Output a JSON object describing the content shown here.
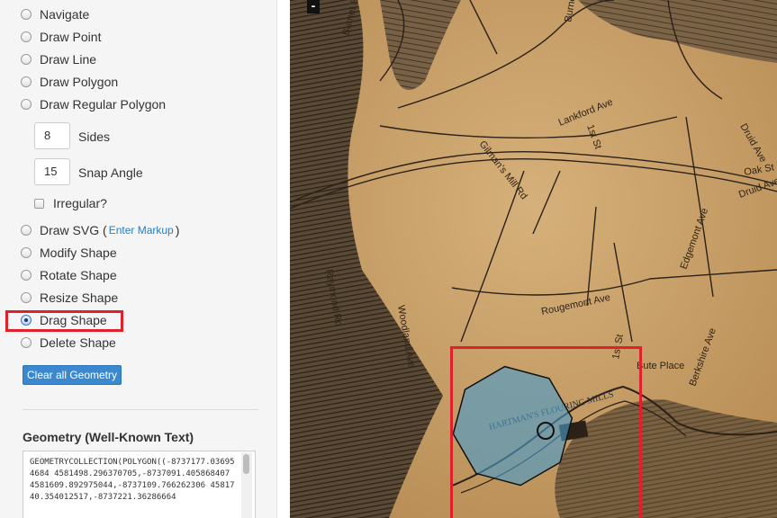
{
  "sidebar": {
    "options": [
      {
        "label": "Navigate",
        "selected": false
      },
      {
        "label": "Draw Point",
        "selected": false
      },
      {
        "label": "Draw Line",
        "selected": false
      },
      {
        "label": "Draw Polygon",
        "selected": false
      },
      {
        "label": "Draw Regular Polygon",
        "selected": false
      }
    ],
    "regular_polygon": {
      "sides_value": "8",
      "sides_label": "Sides",
      "snap_value": "15",
      "snap_label": "Snap Angle",
      "irregular_label": "Irregular?"
    },
    "svg_option": {
      "label": "Draw SVG (",
      "link": "Enter Markup",
      "close": ")"
    },
    "options2": [
      {
        "label": "Modify Shape",
        "selected": false
      },
      {
        "label": "Rotate Shape",
        "selected": false
      },
      {
        "label": "Resize Shape",
        "selected": false
      },
      {
        "label": "Drag Shape",
        "selected": true
      },
      {
        "label": "Delete Shape",
        "selected": false
      }
    ],
    "clear_button": "Clear all Geometry",
    "geometry_title": "Geometry (Well-Known Text)",
    "wkt_text": "GEOMETRYCOLLECTION(POLYGON((-8737177.036954684 4581498.296370705,-8737091.405868407 4581609.892975044,-8737109.766262306 4581740.354012517,-8737221.36286664"
  },
  "map": {
    "zoom_out": "-",
    "streets": [
      "Burnet St",
      "Burnet St",
      "Lankford Ave",
      "Gilman's Mill Rd",
      "1st St",
      "Druid Ave",
      "Druid Ave",
      "Oak St",
      "Rougemont Ave",
      "Edgemont Ave",
      "Woodland Ave",
      "Raymond Rd",
      "1st St",
      "Berkshire Ave",
      "Bute Place"
    ],
    "mill_label": "HARTMAN'S FLOURING MILLS",
    "colors": {
      "paper": "#c89e63",
      "shape_fill": "#4a9bc9",
      "highlight": "#e0202b"
    }
  }
}
